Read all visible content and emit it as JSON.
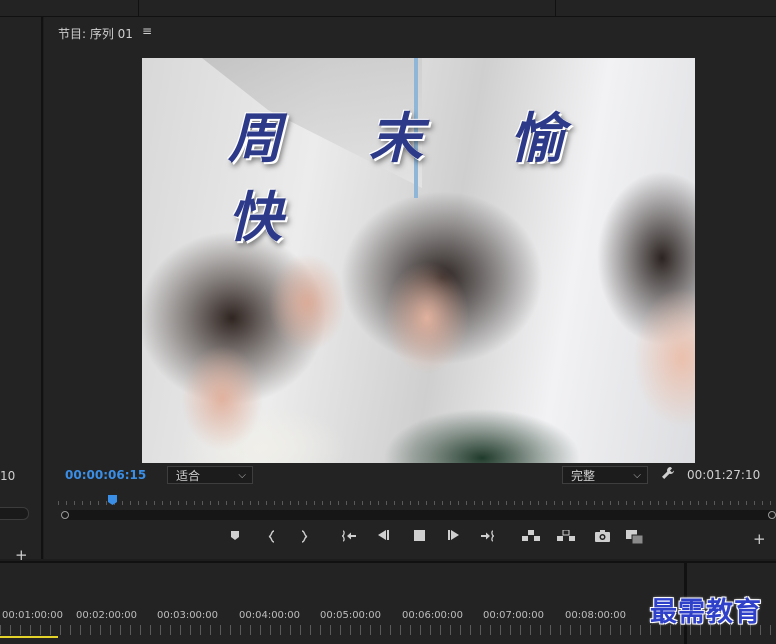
{
  "program_monitor": {
    "title": "节目: 序列 01",
    "menu_icon": "≡",
    "overlay_text": "周 末 愉 快",
    "current_timecode": "00:00:06:15",
    "zoom_select": "适合",
    "resolution_select": "完整",
    "duration_timecode": "00:01:27:10",
    "add_button": "+",
    "chevron": "⌵",
    "transport_icons": [
      "add-marker-icon",
      "mark-in-icon",
      "mark-out-icon",
      "go-to-in-icon",
      "step-back-icon",
      "stop-icon",
      "step-forward-icon",
      "go-to-out-icon",
      "lift-icon",
      "extract-icon",
      "export-frame-icon",
      "compare-view-icon"
    ]
  },
  "left_panel": {
    "timecode_fragment": "10",
    "add_button": "+"
  },
  "timeline": {
    "time_labels": [
      "00:01:00:00",
      "00:02:00:00",
      "00:03:00:00",
      "00:04:00:00",
      "00:05:00:00",
      "00:06:00:00",
      "00:07:00:00",
      "00:08:00:00"
    ]
  },
  "watermark": "最需教育",
  "colors": {
    "accent_blue": "#3a8ee6",
    "panel_bg": "#232323",
    "timeline_bar": "#e2d22a",
    "watermark_blue": "#2f40c9"
  }
}
